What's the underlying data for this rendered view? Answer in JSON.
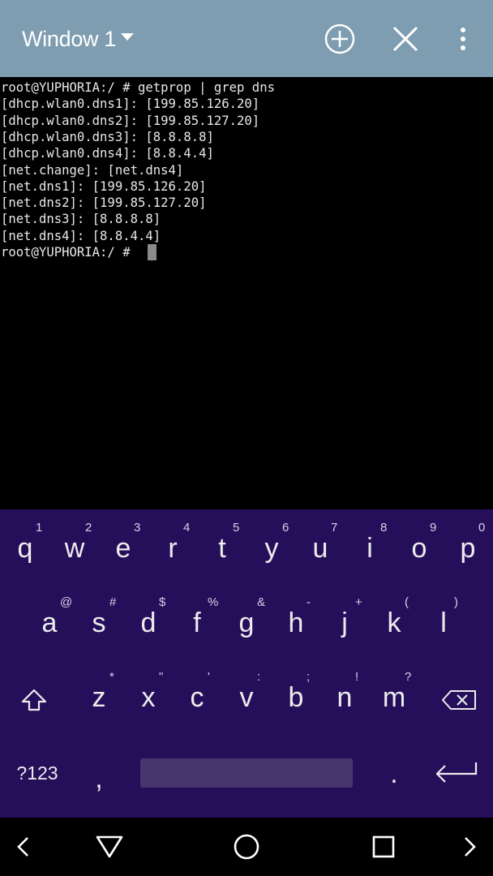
{
  "appbar": {
    "window_title": "Window 1",
    "icons": [
      "dropdown-caret-icon",
      "add-window-icon",
      "close-window-icon",
      "overflow-menu-icon"
    ],
    "bg_color": "#7f9db0"
  },
  "terminal": {
    "lines": [
      "root@YUPHORIA:/ # getprop | grep dns",
      "[dhcp.wlan0.dns1]: [199.85.126.20]",
      "[dhcp.wlan0.dns2]: [199.85.127.20]",
      "[dhcp.wlan0.dns3]: [8.8.8.8]",
      "[dhcp.wlan0.dns4]: [8.8.4.4]",
      "[net.change]: [net.dns4]",
      "[net.dns1]: [199.85.126.20]",
      "[net.dns2]: [199.85.127.20]",
      "[net.dns3]: [8.8.8.8]",
      "[net.dns4]: [8.8.4.4]",
      "root@YUPHORIA:/ # "
    ]
  },
  "keyboard": {
    "bg_color": "#260f5a",
    "row1": [
      {
        "label": "q",
        "hint": "1"
      },
      {
        "label": "w",
        "hint": "2"
      },
      {
        "label": "e",
        "hint": "3"
      },
      {
        "label": "r",
        "hint": "4"
      },
      {
        "label": "t",
        "hint": "5"
      },
      {
        "label": "y",
        "hint": "6"
      },
      {
        "label": "u",
        "hint": "7"
      },
      {
        "label": "i",
        "hint": "8"
      },
      {
        "label": "o",
        "hint": "9"
      },
      {
        "label": "p",
        "hint": "0"
      }
    ],
    "row2": [
      {
        "label": "a",
        "hint": "@"
      },
      {
        "label": "s",
        "hint": "#"
      },
      {
        "label": "d",
        "hint": "$"
      },
      {
        "label": "f",
        "hint": "%"
      },
      {
        "label": "g",
        "hint": "&"
      },
      {
        "label": "h",
        "hint": "-"
      },
      {
        "label": "j",
        "hint": "+"
      },
      {
        "label": "k",
        "hint": "("
      },
      {
        "label": "l",
        "hint": ")"
      }
    ],
    "row3": [
      {
        "label": "z",
        "hint": "*"
      },
      {
        "label": "x",
        "hint": "\""
      },
      {
        "label": "c",
        "hint": "'"
      },
      {
        "label": "v",
        "hint": ":"
      },
      {
        "label": "b",
        "hint": ";"
      },
      {
        "label": "n",
        "hint": "!"
      },
      {
        "label": "m",
        "hint": "?"
      }
    ],
    "symbols_label": "?123",
    "comma_label": ",",
    "period_label": ".",
    "icons": [
      "shift-icon",
      "backspace-icon",
      "enter-icon"
    ]
  },
  "navbar": {
    "icons": [
      "left-arrow-icon",
      "back-icon",
      "home-icon",
      "recents-icon",
      "right-arrow-icon"
    ]
  }
}
